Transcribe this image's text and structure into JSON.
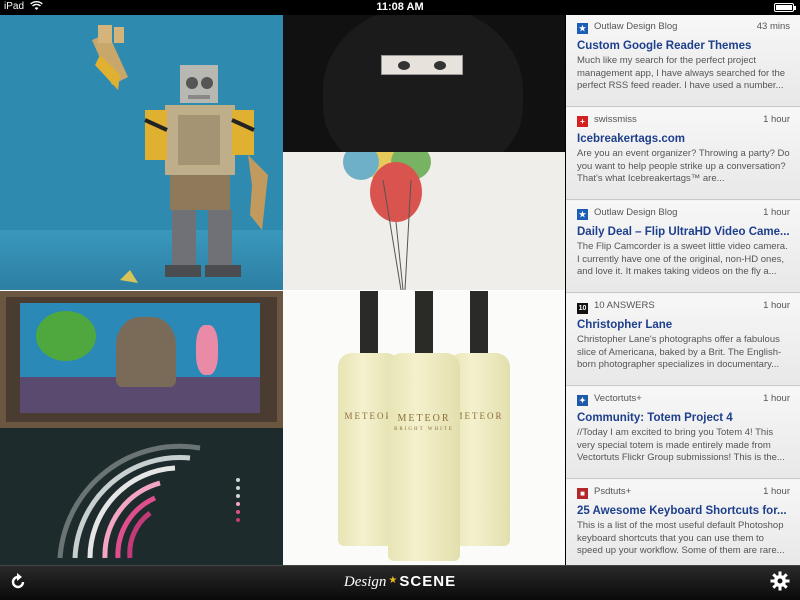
{
  "status_bar": {
    "carrier": "iPad",
    "wifi_icon": "wifi-icon",
    "time": "11:08 AM",
    "battery_level": 0.9
  },
  "bottles": {
    "brand": "METEOR",
    "subtitle": "BRIGHT WHITE"
  },
  "feed": [
    {
      "source": "Outlaw Design Blog",
      "favicon": "star-icon",
      "favicon_color": "#1a5fb4",
      "time": "43 mins",
      "title": "Custom Google Reader Themes",
      "excerpt": "Much like my search for the perfect project management app, I have always searched for the perfect RSS feed reader. I have used a number..."
    },
    {
      "source": "swissmiss",
      "favicon": "swiss-cross-icon",
      "favicon_color": "#d42020",
      "time": "1 hour",
      "title": "Icebreakertags.com",
      "excerpt": "Are you an event organizer? Throwing a party? Do you want to help people strike up a conversation? That's what Icebreakertags™ are..."
    },
    {
      "source": "Outlaw Design Blog",
      "favicon": "star-icon",
      "favicon_color": "#1a5fb4",
      "time": "1 hour",
      "title": "Daily Deal – Flip UltraHD Video Came...",
      "excerpt": "The Flip Camcorder is a sweet little video camera. I currently have one of the original, non-HD ones, and love it. It makes taking videos on the fly a..."
    },
    {
      "source": "10 ANSWERS",
      "favicon": "ten-icon",
      "favicon_color": "#111111",
      "time": "1 hour",
      "title": "Christopher Lane",
      "excerpt": "Christopher Lane's photographs offer a fabulous slice of Americana, baked by a Brit. The English-born photographer specializes in documentary..."
    },
    {
      "source": "Vectortuts+",
      "favicon": "vectortuts-icon",
      "favicon_color": "#1e5aa8",
      "time": "1 hour",
      "title": "Community: Totem Project 4",
      "excerpt": "//Today I am excited to bring you Totem 4! This very special totem is made entirely made from Vectortuts Flickr Group submissions! This is the..."
    },
    {
      "source": "Psdtuts+",
      "favicon": "psdtuts-icon",
      "favicon_color": "#b3262b",
      "time": "1 hour",
      "title": "25 Awesome Keyboard Shortcuts for...",
      "excerpt": "This is a list of the most useful default Photoshop keyboard shortcuts that you can use them to speed up your workflow. Some of them are rare..."
    }
  ],
  "toolbar": {
    "brand_design": "Design",
    "brand_star": "★",
    "brand_scene": "SCENE",
    "refresh_icon": "refresh-icon",
    "settings_icon": "gear-icon"
  }
}
